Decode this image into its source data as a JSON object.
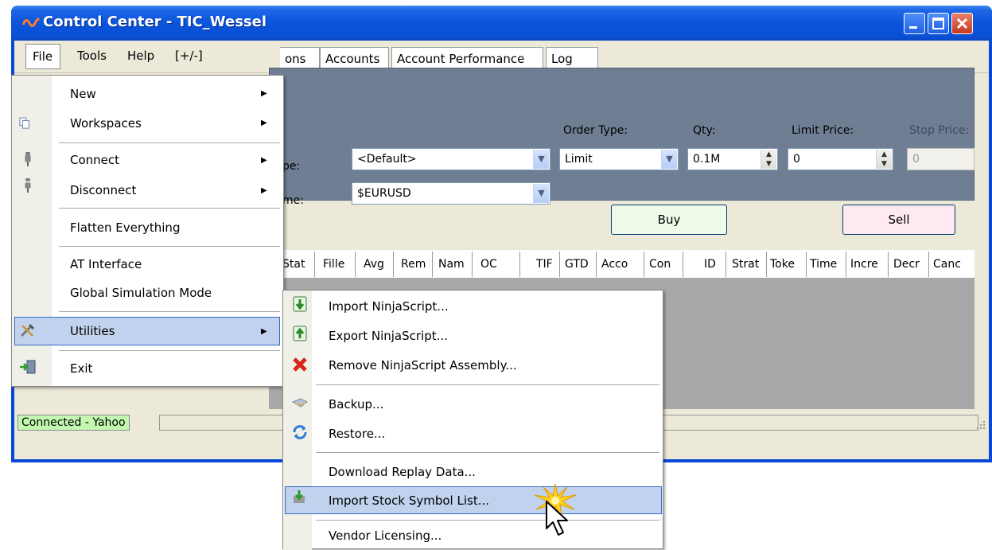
{
  "window": {
    "title": "Control Center - TIC_Wessel",
    "icon": "ninja-wave-icon"
  },
  "menubar": {
    "file": "File",
    "tools": "Tools",
    "help": "Help",
    "toggle": "[+/-]"
  },
  "tabs": [
    "ons",
    "Accounts",
    "Account Performance",
    "Log"
  ],
  "order": {
    "order_type_label": "Order Type:",
    "qty_label": "Qty:",
    "limit_price_label": "Limit Price:",
    "stop_price_label": "Stop Price:",
    "row1_label": "pe:",
    "row2_label": "me:",
    "account_value": "<Default>",
    "instrument_value": "$EURUSD",
    "order_type_value": "Limit",
    "qty_value": "0.1M",
    "limit_price_value": "0",
    "stop_price_value": "0",
    "buy_label": "Buy",
    "sell_label": "Sell"
  },
  "grid_columns": [
    "Stat",
    "Fille",
    "Avg",
    "Rem",
    "Nam",
    "OC",
    "TIF",
    "GTD",
    "Acco",
    "Con",
    "ID",
    "Strat",
    "Toke",
    "Time",
    "Incre",
    "Decr",
    "Canc"
  ],
  "status": {
    "connection": "Connected - Yahoo"
  },
  "file_menu": {
    "new": "New",
    "workspaces": "Workspaces",
    "connect": "Connect",
    "disconnect": "Disconnect",
    "flatten": "Flatten Everything",
    "at_interface": "AT Interface",
    "global_sim": "Global Simulation Mode",
    "utilities": "Utilities",
    "exit": "Exit"
  },
  "utilities_menu": {
    "import_ns": "Import NinjaScript...",
    "export_ns": "Export NinjaScript...",
    "remove_ns": "Remove NinjaScript Assembly...",
    "backup": "Backup...",
    "restore": "Restore...",
    "download_replay": "Download Replay Data...",
    "import_stock": "Import Stock Symbol List...",
    "vendor_licensing": "Vendor Licensing..."
  },
  "colors": {
    "title_blue": "#0a55dc",
    "panel_slate": "#707e94",
    "menu_highlight": "#c1d2ee",
    "status_green": "#c3f8b0",
    "buy_bg": "#eefbe8",
    "sell_bg": "#fde9ef"
  }
}
